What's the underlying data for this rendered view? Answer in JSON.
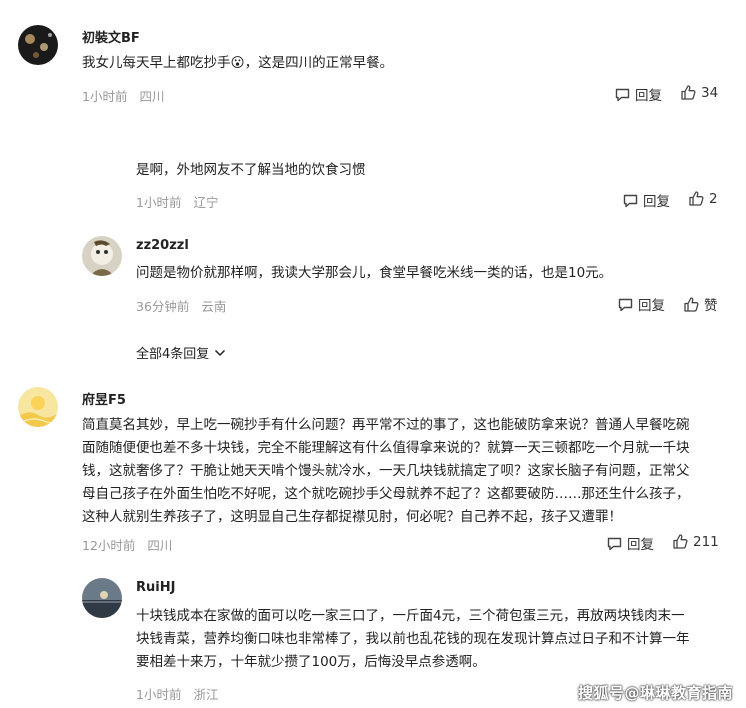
{
  "comments": [
    {
      "username": "初裝文BF",
      "text": "我女儿每天早上都吃抄手😮，这是四川的正常早餐。",
      "time": "1小时前",
      "location": "四川",
      "reply_label": "回复",
      "like_count": "34"
    },
    {
      "username": "",
      "text": "是啊，外地网友不了解当地的饮食习惯",
      "time": "1小时前",
      "location": "辽宁",
      "reply_label": "回复",
      "like_count": "2"
    },
    {
      "username": "zz20zzl",
      "text": "问题是物价就那样啊，我读大学那会儿，食堂早餐吃米线一类的话，也是10元。",
      "time": "36分钟前",
      "location": "云南",
      "reply_label": "回复",
      "like_count": "赞"
    },
    {
      "username": "府昱F5",
      "text_lines": [
        "简直莫名其妙，早上吃一碗抄手有什么问题？再平常不过的事了，这也能破防拿来说？普通人早餐吃碗",
        "面随随便便也差不多十块钱，完全不能理解这有什么值得拿来说的？就算一天三顿都吃一个月就一千块",
        "钱，这就奢侈了？干脆让她天天啃个馒头就冷水，一天几块钱就搞定了呗？这家长脑子有问题，正常父",
        "母自己孩子在外面生怕吃不好呢，这个就吃碗抄手父母就养不起了？这都要破防……那还生什么孩子，",
        "这种人就别生养孩子了，这明显自己生存都捉襟见肘，何必呢？自己养不起，孩子又遭罪！"
      ],
      "time": "12小时前",
      "location": "四川",
      "reply_label": "回复",
      "like_count": "211"
    },
    {
      "username": "RuiHJ",
      "text_lines": [
        "十块钱成本在家做的面可以吃一家三口了，一斤面4元，三个荷包蛋三元，再放两块钱肉末一",
        "块钱青菜，营养均衡口味也非常棒了，我以前也乱花钱的现在发现计算点过日子和不计算一年",
        "要相差十来万，十年就少攒了100万，后悔没早点参透啊。"
      ],
      "time": "1小时前",
      "location": "浙江"
    }
  ],
  "show_all_replies": "全部4条回复",
  "watermark": "搜狐号@琳琳教育指南"
}
